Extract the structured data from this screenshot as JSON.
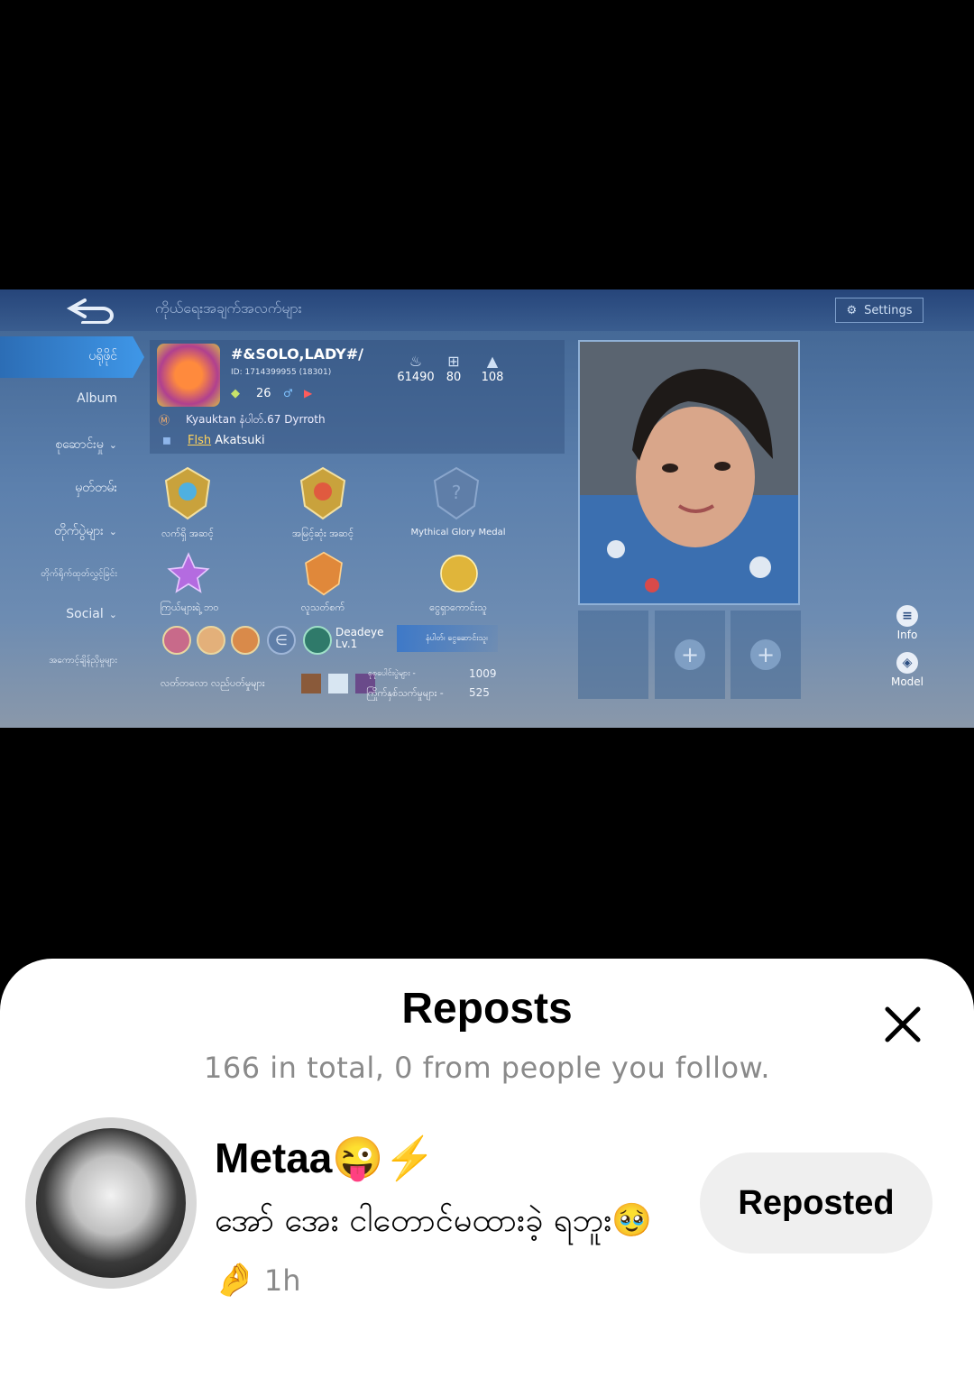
{
  "game": {
    "title": "ကိုယ်ရေးအချက်အလက်များ",
    "settings_label": "Settings",
    "side_menu": [
      {
        "label": "ပရိုဖိုင်",
        "active": true
      },
      {
        "label": "Album"
      },
      {
        "label": "စုဆောင်းမှု"
      },
      {
        "label": "မှတ်တမ်း"
      },
      {
        "label": "တိုက်ပွဲများ"
      },
      {
        "label": "တိုက်ရိုက်ထုတ်လွှင့်ခြင်း"
      },
      {
        "label": "Social"
      },
      {
        "label": "အကောင့်ချိန်ညှိမှုများ"
      }
    ],
    "player": {
      "name": "#&SOLO,LADY#/",
      "id": "ID: 1714399955 (18301)",
      "level": "26",
      "guild": "Kyauktan နံပါတ်.67 Dyrroth",
      "squad_tag": "Flsh",
      "squad_name": "Akatsuki"
    },
    "stats": [
      {
        "icon": "flame-icon",
        "value": "61490"
      },
      {
        "icon": "gift-icon",
        "value": "80"
      },
      {
        "icon": "thumbs-up-icon",
        "value": "108"
      }
    ],
    "medals": [
      {
        "label": "လက်ရှိ အဆင့်"
      },
      {
        "label": "အမြင့်ဆုံး အဆင့်"
      },
      {
        "label": "Mythical Glory Medal"
      },
      {
        "label": "ကြယ်များရဲ့ ဘဝ"
      },
      {
        "label": "လူသတ်စက်"
      },
      {
        "label": "ငွေရှာကောင်းသူ"
      }
    ],
    "deadeye": {
      "title": "Deadeye",
      "level": "Lv.1"
    },
    "rank_chip": "နံပါတ်၊ ငွေဆောင်းသူ၊",
    "recent_label": "လတ်တလော လည်ပတ်မှုများ",
    "matches_label": "စုစုပေါင်းပွဲများ -",
    "matches_value": "1009",
    "mvp_label": "ကြိုက်နှစ်သက်မှုများ -",
    "mvp_value": "525",
    "info_label": "Info",
    "model_label": "Model"
  },
  "sheet": {
    "title": "Reposts",
    "subtitle": "166 in total, 0 from people you follow.",
    "user": {
      "name": "Metaa😜⚡",
      "message": "အော် အေး ငါတောင်မထားခဲ့ ရဘူး🥹🤌",
      "time": "1h",
      "button_label": "Reposted"
    }
  },
  "colors": {
    "sheet_bg": "#ffffff",
    "button_bg": "#efefef",
    "muted_text": "#8a8a8a"
  }
}
